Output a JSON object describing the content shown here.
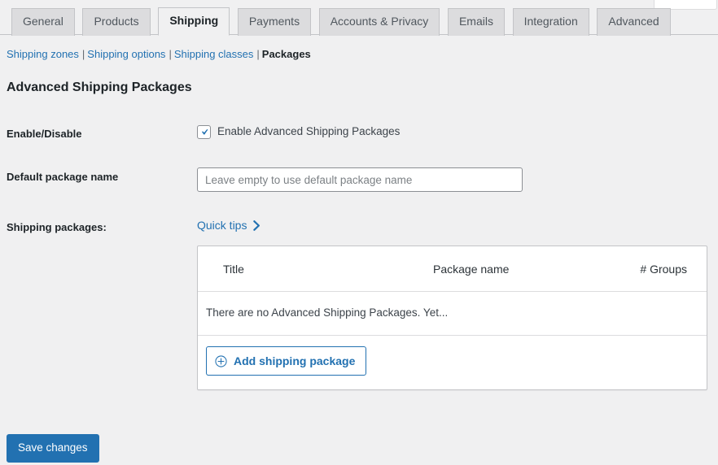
{
  "tabs": [
    {
      "label": "General",
      "active": false
    },
    {
      "label": "Products",
      "active": false
    },
    {
      "label": "Shipping",
      "active": true
    },
    {
      "label": "Payments",
      "active": false
    },
    {
      "label": "Accounts & Privacy",
      "active": false
    },
    {
      "label": "Emails",
      "active": false
    },
    {
      "label": "Integration",
      "active": false
    },
    {
      "label": "Advanced",
      "active": false
    }
  ],
  "subnav": {
    "items": [
      {
        "label": "Shipping zones",
        "current": false
      },
      {
        "label": "Shipping options",
        "current": false
      },
      {
        "label": "Shipping classes",
        "current": false
      },
      {
        "label": "Packages",
        "current": true
      }
    ],
    "separator": "|"
  },
  "page": {
    "title": "Advanced Shipping Packages"
  },
  "settings": {
    "enable": {
      "label": "Enable/Disable",
      "checkbox_label": "Enable Advanced Shipping Packages",
      "checked": true
    },
    "default_package_name": {
      "label": "Default package name",
      "value": "",
      "placeholder": "Leave empty to use default package name"
    },
    "shipping_packages": {
      "label": "Shipping packages:",
      "quick_tips_label": "Quick tips"
    }
  },
  "packages_table": {
    "columns": [
      "Title",
      "Package name",
      "# Groups"
    ],
    "rows": [],
    "empty_message": "There are no Advanced Shipping Packages. Yet...",
    "add_button_label": "Add shipping package"
  },
  "footer": {
    "save_label": "Save changes"
  },
  "colors": {
    "accent": "#2271b1",
    "background": "#f0f0f1",
    "tab_inactive": "#dcdcde",
    "border": "#c3c4c7",
    "text": "#3c434a"
  }
}
